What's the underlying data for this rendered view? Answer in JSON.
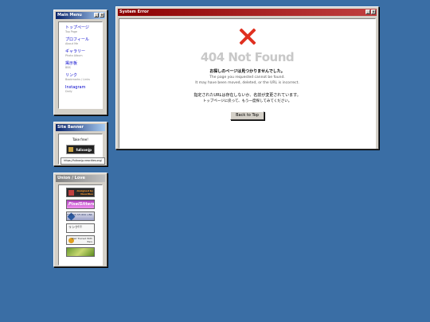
{
  "menu_window": {
    "title": "Main Menu",
    "items": [
      {
        "jp": "トップページ",
        "en": "Top Page"
      },
      {
        "jp": "プロフィール",
        "en": "About Me"
      },
      {
        "jp": "ギャラリー",
        "en": "Photo Album"
      },
      {
        "jp": "掲示板",
        "en": "BBS"
      },
      {
        "jp": "リンク",
        "en": "Bookmarks / Links"
      },
      {
        "jp": "Instagram",
        "en": "Daily"
      }
    ]
  },
  "banner_window": {
    "title": "Site Banner",
    "take_free": "Take free!",
    "banner_text": "fuliconjp",
    "url": "https://fuliconjp.neocities.org/"
  },
  "links_window": {
    "title": "Union / Love",
    "banners": [
      {
        "text": "designed by Neocities"
      },
      {
        "text": "PixelSitters"
      },
      {
        "text": "FOSTAS STUDIO LINK"
      },
      {
        "text": "リンク!!!"
      },
      {
        "text": "Wed Trained With Ears"
      },
      {
        "text": ""
      }
    ]
  },
  "error_window": {
    "title": "System Error",
    "heading": "404 Not Found",
    "line_jp1": "お探しのページは見つかりませんでした。",
    "line_en1": "The page you requested cannot be found.",
    "line_en2": "It may have been moved, deleted, or the URL is incorrect.",
    "line_jp2": "指定されたURLは存在しないか、名前が変更されています。",
    "line_jp3": "トップページに戻って、もう一度探してみてください。",
    "button": "Back to Top"
  },
  "colors": {
    "desktop": "#3a6ea5",
    "window_face": "#d4d0c8",
    "title_blue": "#0a246a",
    "title_red": "#8b0000",
    "error_x": "#e03020"
  }
}
